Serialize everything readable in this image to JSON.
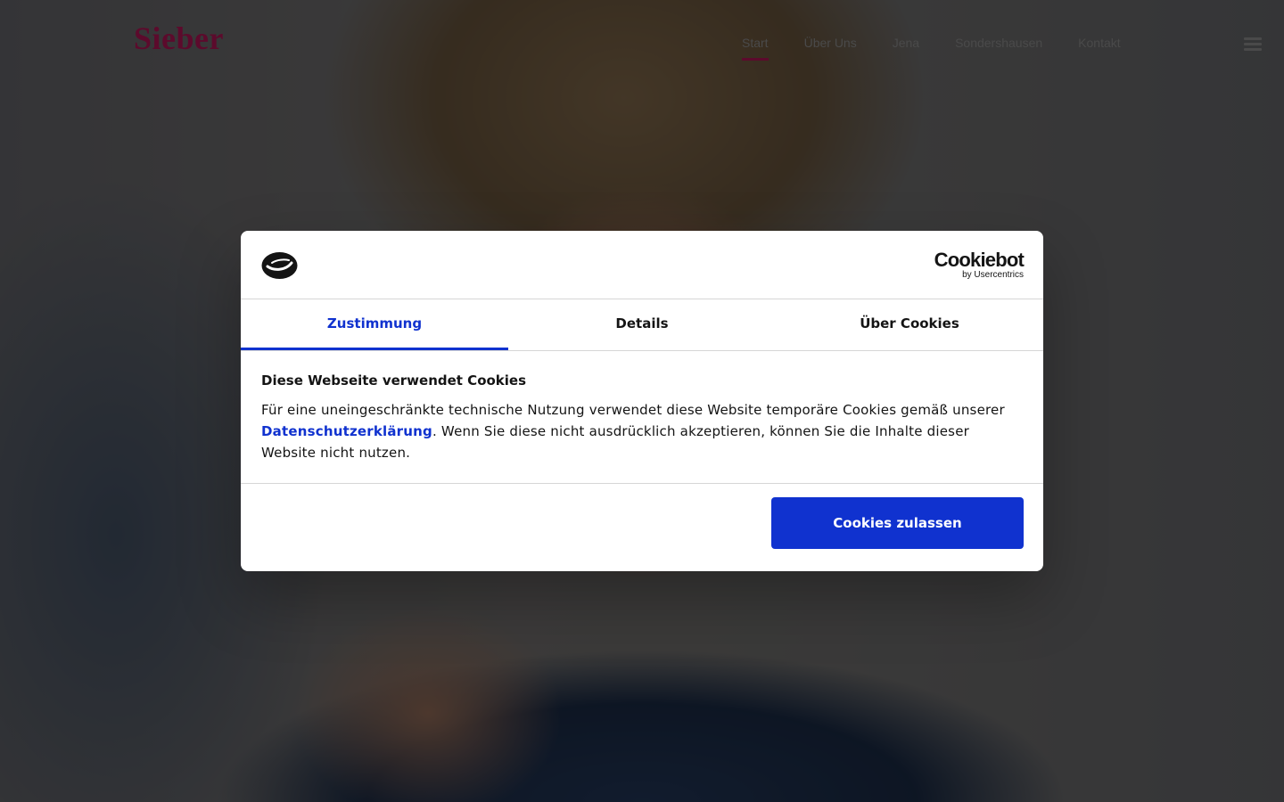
{
  "site": {
    "logo_text": "Sieber",
    "nav": [
      "Start",
      "Über Uns",
      "Jena",
      "Sondershausen",
      "Kontakt"
    ],
    "active_nav": "Start",
    "brand_color": "#5c0a2c"
  },
  "cookie_dialog": {
    "provider_name": "Cookiebot",
    "provider_sub": "by Usercentrics",
    "tabs": [
      "Zustimmung",
      "Details",
      "Über Cookies"
    ],
    "active_tab": "Zustimmung",
    "heading": "Diese Webseite verwendet Cookies",
    "text_before_link": "Für eine uneingeschränkte technische Nutzung verwendet diese Website temporäre Cookies gemäß unserer ",
    "link_text": "Datenschutzerklärung",
    "text_after_link": ". Wenn Sie diese nicht ausdrücklich akzeptieren, können Sie die Inhalte dieser Website nicht nutzen.",
    "allow_button": "Cookies zulassen",
    "accent_color": "#1032cf",
    "icons": [
      "cookiebot-logo-icon",
      "hamburger-menu-icon"
    ]
  }
}
